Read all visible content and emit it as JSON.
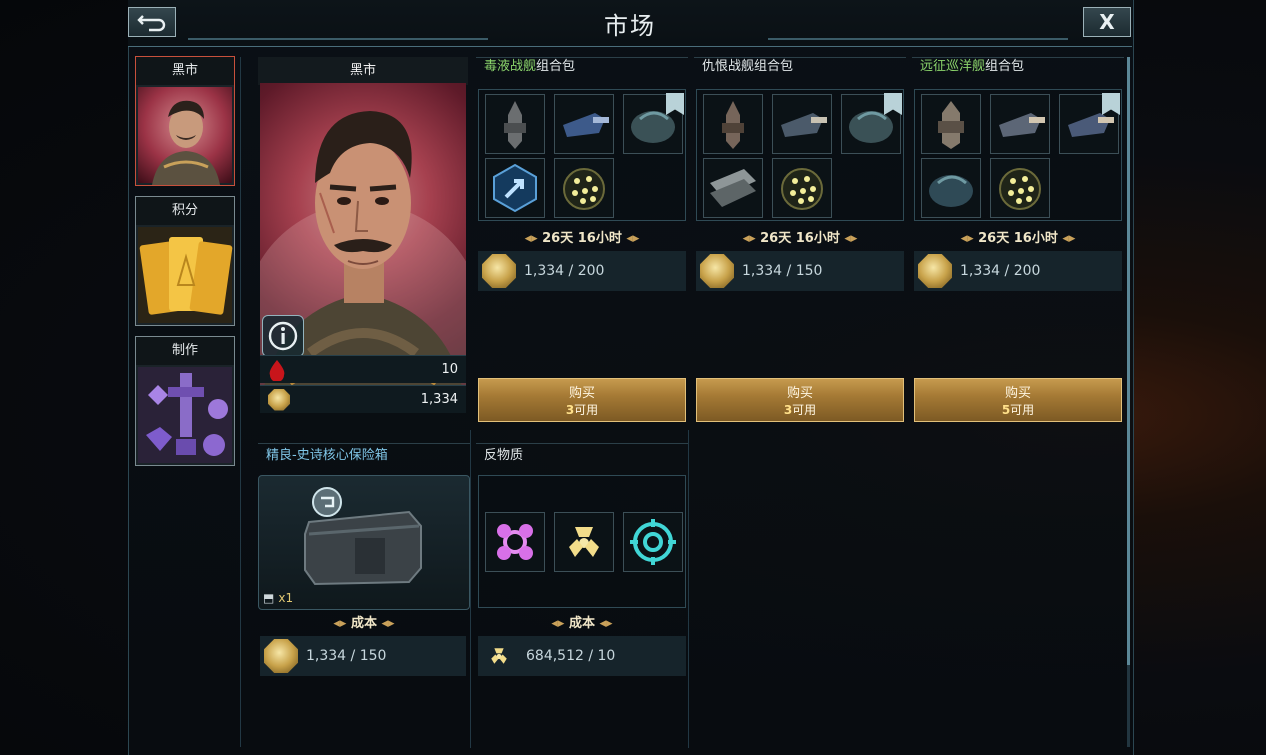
{
  "header": {
    "title": "市场",
    "back_icon": "back-arrow-icon",
    "close_label": "X"
  },
  "sidebar": {
    "items": [
      {
        "label": "黑市",
        "active": true
      },
      {
        "label": "积分",
        "active": false
      },
      {
        "label": "制作",
        "active": false
      }
    ]
  },
  "merchant": {
    "name": "黑市",
    "info_icon": "info-icon",
    "stats": [
      {
        "icon": "blood-drop-icon",
        "value": "10"
      },
      {
        "icon": "gold-coin-icon",
        "value": "1,334"
      }
    ]
  },
  "packs": [
    {
      "title_highlight": "毒液战舰",
      "title_rest": "组合包",
      "highlight_color": "#8bd36b",
      "timer": "26天 16小时",
      "price": "1,334 / 200",
      "buy_label": "购买",
      "available_num": "3",
      "available_suffix": "可用"
    },
    {
      "title_highlight": "",
      "title_rest": "仇恨战舰组合包",
      "highlight_color": "#e2e8ea",
      "timer": "26天 16小时",
      "price": "1,334 / 150",
      "buy_label": "购买",
      "available_num": "3",
      "available_suffix": "可用"
    },
    {
      "title_highlight": "远征巡洋舰",
      "title_rest": "组合包",
      "highlight_color": "#8bd36b",
      "timer": "26天 16小时",
      "price": "1,334 / 200",
      "buy_label": "购买",
      "available_num": "5",
      "available_suffix": "可用"
    }
  ],
  "lower": {
    "bonus": {
      "title": "精良-史诗核心保险箱",
      "count": "x1",
      "cost_label": "成本",
      "price": "1,334 / 150"
    },
    "antimatter": {
      "title": "反物质",
      "cost_label": "成本",
      "price": "684,512 / 10"
    }
  }
}
